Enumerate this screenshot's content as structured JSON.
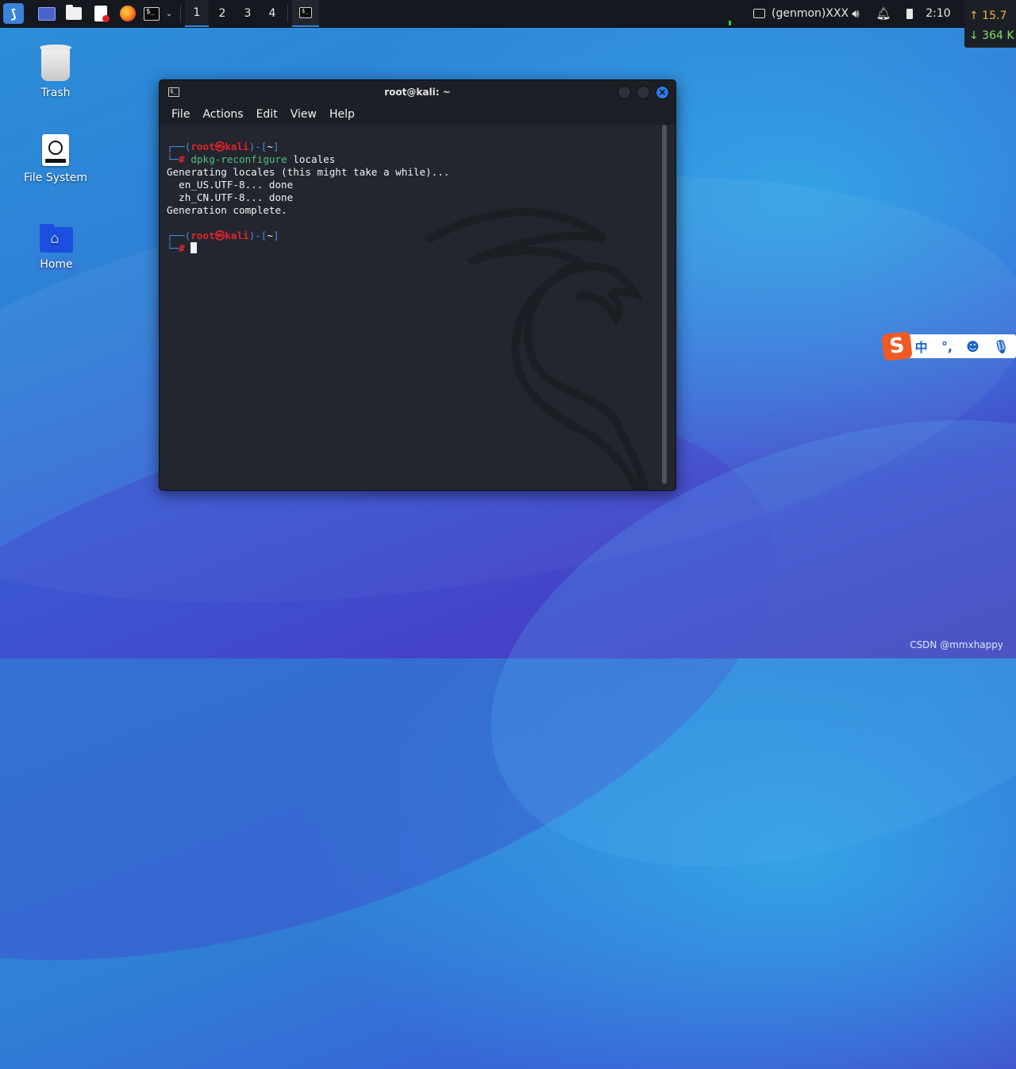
{
  "panel": {
    "workspaces": [
      "1",
      "2",
      "3",
      "4"
    ],
    "active_workspace": "1",
    "genmon": "(genmon)XXX",
    "clock": "2:10",
    "net_up": "↑ 15.7",
    "net_down": "↓ 364 K"
  },
  "desktop": {
    "icons": [
      {
        "label": "Trash"
      },
      {
        "label": "File System"
      },
      {
        "label": "Home"
      }
    ]
  },
  "terminal": {
    "title": "root@kali: ~",
    "menu": [
      "File",
      "Actions",
      "Edit",
      "View",
      "Help"
    ],
    "prompt_user": "root",
    "prompt_sep": "㉿",
    "prompt_host": "kali",
    "prompt_dir": "~",
    "command": "dpkg-reconfigure",
    "command_arg": " locales",
    "output": [
      "Generating locales (this might take a while)...",
      "  en_US.UTF-8... done",
      "  zh_CN.UTF-8... done",
      "Generation complete."
    ]
  },
  "ime": {
    "logo": "S",
    "mode": "中",
    "punct": "°,",
    "emoji": "☻",
    "mic": "🎙"
  },
  "watermark": "CSDN @mmxhappy"
}
